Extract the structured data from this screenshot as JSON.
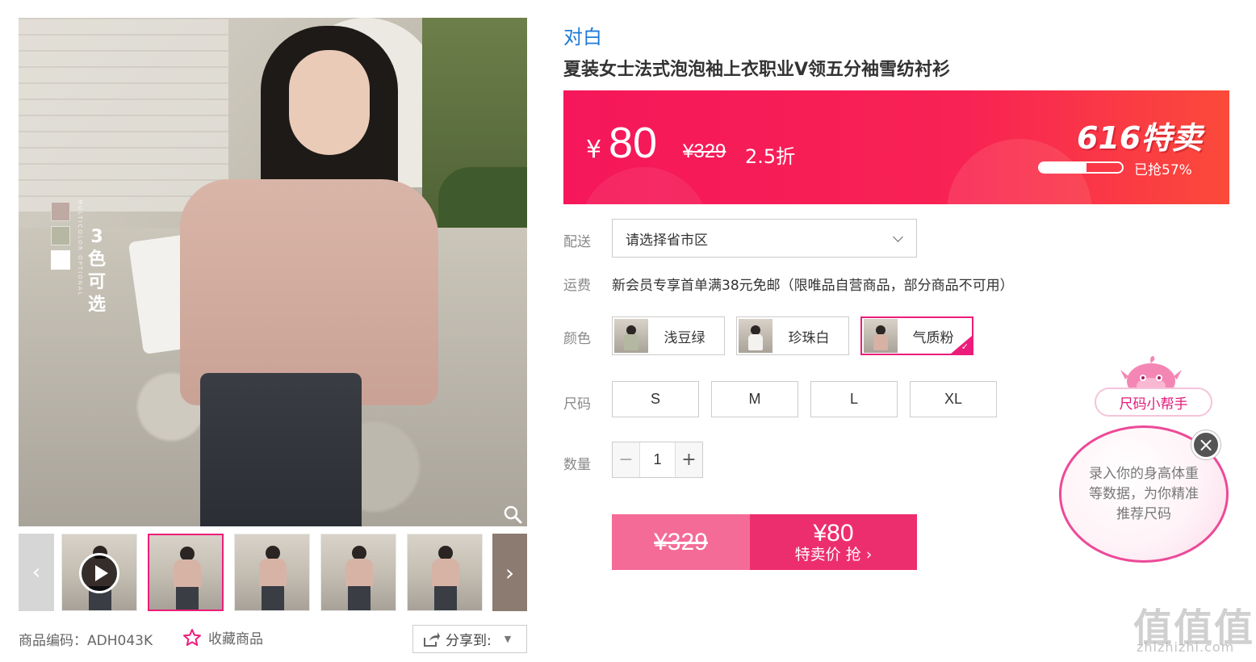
{
  "gallery": {
    "color_count_text": "3\n色\n可\n选",
    "multicolor_caption": "MULTICOLOR OPTIONAL",
    "swatch_colors": [
      "#bfa9a3",
      "#b7b8a3",
      "#ffffff"
    ],
    "thumbnails_count": 5,
    "active_thumbnail": 2
  },
  "meta": {
    "sku_label": "商品编码：ADH043K",
    "favorite_label": "收藏商品",
    "share_label": "分享到:"
  },
  "product": {
    "brand": "对白",
    "title": "夏装女士法式泡泡袖上衣职业V领五分袖雪纺衬衫"
  },
  "price": {
    "currency": "¥",
    "current": "80",
    "original": "¥329",
    "discount": "2.5折",
    "promo": "616特卖",
    "sold_percent": 57,
    "sold_text": "已抢57%"
  },
  "delivery": {
    "label": "配送",
    "placeholder": "请选择省市区"
  },
  "shipping": {
    "label": "运费",
    "text": "新会员专享首单满38元免邮（限唯品自营商品，部分商品不可用）"
  },
  "colors": {
    "label": "颜色",
    "options": [
      {
        "name": "浅豆绿",
        "shirt": "#b5b8a0"
      },
      {
        "name": "珍珠白",
        "shirt": "#f4f2ee"
      },
      {
        "name": "气质粉",
        "shirt": "#d6b1a4"
      }
    ],
    "selected": "气质粉"
  },
  "sizes": {
    "label": "尺码",
    "options": [
      "S",
      "M",
      "L",
      "XL"
    ]
  },
  "quantity": {
    "label": "数量",
    "value": "1",
    "minus": "−",
    "plus": "+"
  },
  "buy": {
    "original": "¥329",
    "price": "¥80",
    "cta": "特卖价 抢 ›"
  },
  "size_helper": {
    "tag": "尺码小帮手",
    "text": "录入你的身高体重等数据，为你精准推荐尺码",
    "close": "×"
  },
  "watermark": {
    "logo": "值值值",
    "url": "zhizhizhi.com"
  },
  "colors_theme": {
    "accent": "#ec1d7a",
    "brand_blue": "#1f7bd6",
    "price_bar": "#f5175a"
  }
}
